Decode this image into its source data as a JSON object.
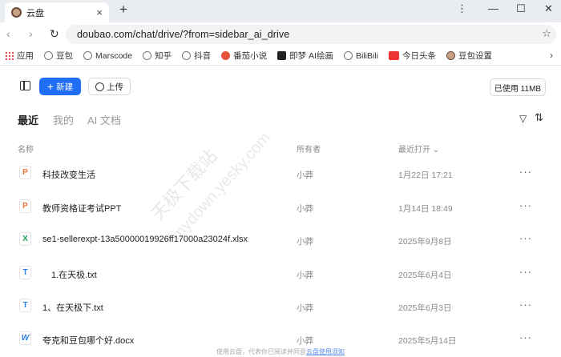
{
  "browser": {
    "tab_title": "云盘",
    "new_tab": "+",
    "tab_close": "×",
    "controls": {
      "menu": "⋮",
      "minimize": "—",
      "maximize": "☐",
      "close": "✕"
    },
    "url": "doubao.com/chat/drive/?from=sidebar_ai_drive",
    "bookmarks": [
      "应用",
      "豆包",
      "Marscode",
      "知乎",
      "抖音",
      "番茄小说",
      "即梦 AI绘画",
      "BiliBili",
      "今日头条",
      "豆包设置"
    ]
  },
  "toolbar": {
    "new_label": "新建",
    "upload_label": "上传",
    "usage_label": "已使用 11MB"
  },
  "view_tabs": [
    "最近",
    "我的",
    "AI 文档"
  ],
  "columns": {
    "name": "名称",
    "owner": "所有者",
    "opened": "最近打开 ⌄"
  },
  "files": [
    {
      "icon": "ppt",
      "name": "科技改变生活",
      "owner": "小莽",
      "opened": "1月22日 17:21"
    },
    {
      "icon": "ppt",
      "name": "教师资格证考试PPT",
      "owner": "小莽",
      "opened": "1月14日 18:49"
    },
    {
      "icon": "xls",
      "name": "se1-sellerexpt-13a50000019926ff17000a23024f.xlsx",
      "owner": "小莽",
      "opened": "2025年9月8日"
    },
    {
      "icon": "txt",
      "name": "1.在天极.txt",
      "owner": "小莽",
      "opened": "2025年6月4日"
    },
    {
      "icon": "txt",
      "name": "1、在天极下.txt",
      "owner": "小莽",
      "opened": "2025年6月3日"
    },
    {
      "icon": "doc",
      "name": "夸克和豆包哪个好.docx",
      "owner": "小莽",
      "opened": "2025年5月14日"
    }
  ],
  "footer": {
    "text": "使用云盘，代表你已阅读并同意",
    "link": "云盘使用须知"
  },
  "watermark": {
    "line1": "天极下载站",
    "line2": "mydown.yesky.com"
  }
}
